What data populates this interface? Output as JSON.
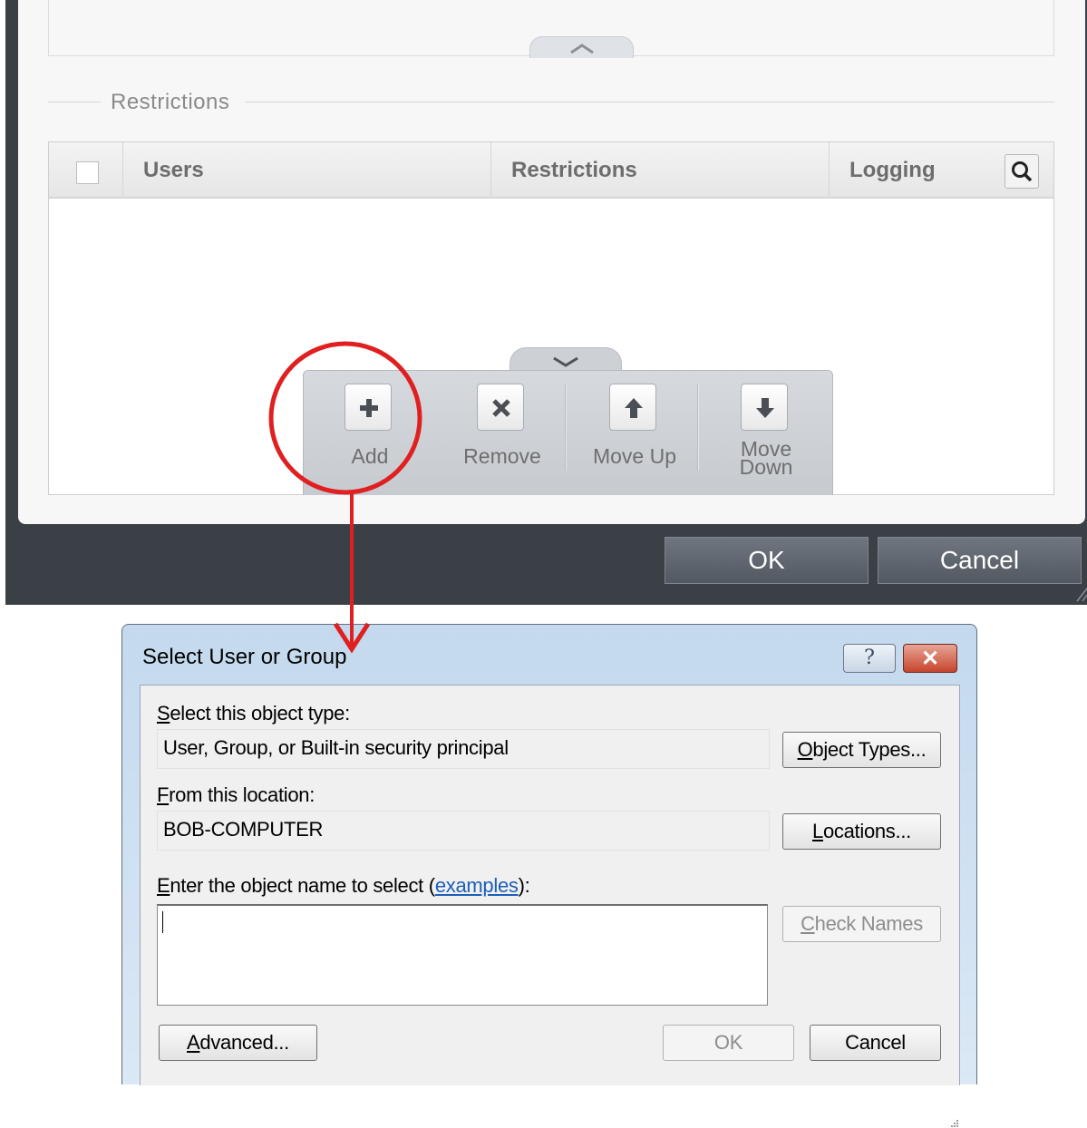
{
  "top_panel": {
    "section_title": "Restrictions",
    "columns": [
      {
        "label": "Users"
      },
      {
        "label": "Restrictions"
      },
      {
        "label": "Logging"
      }
    ],
    "toolbar": [
      {
        "label": "Add",
        "icon": "plus-icon"
      },
      {
        "label": "Remove",
        "icon": "x-icon"
      },
      {
        "label": "Move Up",
        "icon": "arrow-up-icon"
      },
      {
        "label_line1": "Move",
        "label_line2": "Down",
        "icon": "arrow-down-icon"
      }
    ],
    "ok_label": "OK",
    "cancel_label": "Cancel"
  },
  "annotation": {
    "color": "#e02020"
  },
  "dialog": {
    "title": "Select User or Group",
    "help_glyph": "?",
    "close_glyph": "✕",
    "object_type": {
      "label_hotkey": "S",
      "label_rest": "elect this object type:",
      "value": "User, Group, or Built-in security principal",
      "button_hotkey": "O",
      "button_rest": "bject Types..."
    },
    "location": {
      "label_hotkey": "F",
      "label_rest": "rom this location:",
      "value": "BOB-COMPUTER",
      "button_hotkey": "L",
      "button_rest": "ocations..."
    },
    "object_name": {
      "label_hotkey": "E",
      "label_rest": "nter the object name to select (",
      "link": "examples",
      "label_end": "):",
      "value": "",
      "check_hotkey": "C",
      "check_rest": "heck Names"
    },
    "advanced_hotkey": "A",
    "advanced_rest": "dvanced...",
    "ok_label": "OK",
    "cancel_label": "Cancel"
  }
}
